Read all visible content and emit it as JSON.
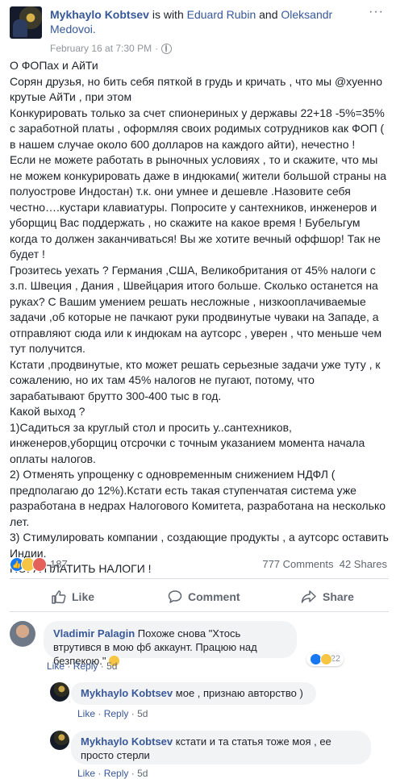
{
  "post": {
    "author": "Mykhaylo Kobtsev",
    "with_text": " is with ",
    "tagged_1": "Eduard Rubin",
    "and_text": " and ",
    "tagged_2": "Oleksandr Medovoi.",
    "timestamp": "February 16 at 7:30 PM",
    "separator": "·",
    "more": "···",
    "lines": [
      "О ФОПах и АйТи",
      "Сорян друзья, но бить себя пяткой в грудь и кричать , что мы @хуенно крутые АйТи , при этом",
      "Конкурировать только за счет спионериных у державы 22+18 -5%=35% с заработной платы , оформляя своих родимых сотрудников как ФОП ( в нашем случае около 600 долларов на каждого айти), нечестно !",
      "Если не можете работать в рыночных условиях , то и скажите, что мы не можем конкурировать даже в индюками( жители большой страны на полуострове Индостан) т.к. они умнее и дешевле .Назовите себя честно….кустари клавиатуры. Попросите у сантехников, инженеров и уборщиц Вас поддержать , но скажите на какое время ! Бубельгум когда то должен заканчиваться! Вы же хотите вечный оффшор! Так не будет !",
      "Грозитесь уехать ? Германия ,США, Великобритания от 45% налоги с з.п. Швеция , Дания , Швейцария итого больше. Сколько останется на руках? С Вашим умением решать несложные , низкооплачиваемые задачи ,об которые не пачкают руки продвинутые чуваки на Западе, а отправляют сюда или к индюкам на аутсорс , уверен , что меньше чем тут получится.",
      "Кстати ,продвинутые, кто может решать серьезные задачи уже туту , к сожалению, но их там 45% налогов не пугают, потому, что зарабатывают брутто 300-400 тыс в год.",
      "Какой выход ?",
      "1)Садиться за круглый стол и просить у..сантехников, инженеров,уборщиц отсрочки с точным указанием момента начала оплаты налогов.",
      "2) Отменять упрощенку с одновременным снижением НДФЛ ( предполагаю до 12%).Кстати есть такая ступенчатая система уже разработана в недрах Налогового Комитета, разработана на несколько лет.",
      "3) Стимулировать компании , создающие продукты , а аутсорс оставить Индии.",
      "ПОРА ПЛАТИТЬ НАЛОГИ !"
    ],
    "reaction_count": "187",
    "comments_count": "777 Comments",
    "shares_count": "42 Shares"
  },
  "actions": {
    "like": "Like",
    "comment": "Comment",
    "share": "Share"
  },
  "comments": [
    {
      "name": "Vladimir Palagin",
      "text": "Похоже снова \"Хтось втрутився в мою фб аккаунт. Працюю над безпекою.\"",
      "like": "Like",
      "reply": "Reply",
      "time": "5d",
      "reactions": "22"
    },
    {
      "name": "Mykhaylo Kobtsev",
      "text": "мое , признаю авторство )",
      "like": "Like",
      "reply": "Reply",
      "time": "5d"
    },
    {
      "name": "Mykhaylo Kobtsev",
      "text": "кстати и та статья тоже моя , ее просто стерли",
      "like": "Like",
      "reply": "Reply",
      "time": "5d"
    }
  ],
  "meta_dot": "·",
  "colors": {
    "link": "#365899",
    "meta": "#90949c",
    "bubble": "#f2f3f5",
    "like_blue": "#1877f2"
  }
}
